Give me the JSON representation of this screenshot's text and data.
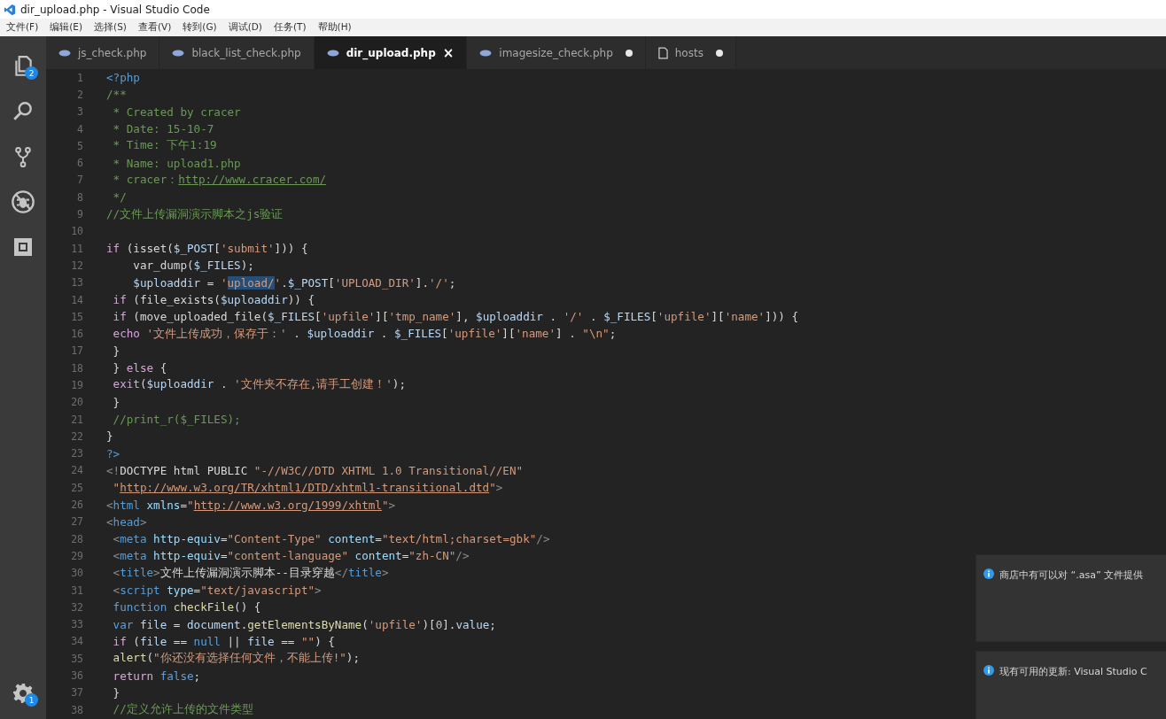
{
  "window": {
    "title": "dir_upload.php - Visual Studio Code"
  },
  "menu": [
    "文件(F)",
    "编辑(E)",
    "选择(S)",
    "查看(V)",
    "转到(G)",
    "调试(D)",
    "任务(T)",
    "帮助(H)"
  ],
  "activity_bar": {
    "items": [
      {
        "kind": "files",
        "badge": "2"
      },
      {
        "kind": "search"
      },
      {
        "kind": "git"
      },
      {
        "kind": "debug"
      },
      {
        "kind": "extensions"
      }
    ],
    "bottom": {
      "kind": "settings",
      "badge": "1"
    }
  },
  "tabs": [
    {
      "label": "js_check.php",
      "kind": "php",
      "selected": false,
      "dirty": false
    },
    {
      "label": "black_list_check.php",
      "kind": "php",
      "selected": false,
      "dirty": false
    },
    {
      "label": "dir_upload.php",
      "kind": "php",
      "selected": true,
      "dirty": false,
      "close": "×"
    },
    {
      "label": "imagesize_check.php",
      "kind": "php",
      "selected": false,
      "dirty": true
    },
    {
      "label": "hosts",
      "kind": "file",
      "selected": false,
      "dirty": true
    }
  ],
  "code": [
    {
      "num": "1",
      "tokens": [
        {
          "kind": "tag",
          "text": "<?php"
        }
      ]
    },
    {
      "num": "2",
      "tokens": [
        {
          "kind": "com",
          "text": "/**"
        }
      ]
    },
    {
      "num": "3",
      "tokens": [
        {
          "kind": "com",
          "text": " * Created by cracer"
        }
      ]
    },
    {
      "num": "4",
      "tokens": [
        {
          "kind": "com",
          "text": " * Date: 15-10-7"
        }
      ]
    },
    {
      "num": "5",
      "tokens": [
        {
          "kind": "com",
          "text": " * Time: 下午1:19"
        }
      ]
    },
    {
      "num": "6",
      "tokens": [
        {
          "kind": "com",
          "text": " * Name: upload1.php"
        }
      ]
    },
    {
      "num": "7",
      "tokens": [
        {
          "kind": "com",
          "text": " * cracer："
        },
        {
          "kind": "comlink",
          "text": "http://www.cracer.com/"
        }
      ]
    },
    {
      "num": "8",
      "tokens": [
        {
          "kind": "com",
          "text": " */"
        }
      ]
    },
    {
      "num": "9",
      "tokens": [
        {
          "kind": "com",
          "text": "//文件上传漏洞演示脚本之js验证"
        }
      ]
    },
    {
      "num": "10"
    },
    {
      "num": "11",
      "tokens": [
        {
          "kind": "kw",
          "text": "if"
        },
        {
          "kind": "p",
          "text": " (isset("
        },
        {
          "kind": "var",
          "text": "$_POST"
        },
        {
          "kind": "p",
          "text": "["
        },
        {
          "kind": "str",
          "text": "'submit'"
        },
        {
          "kind": "p",
          "text": "])) {"
        }
      ]
    },
    {
      "num": "12",
      "tokens": [
        {
          "kind": "p",
          "text": "    var_dump("
        },
        {
          "kind": "var",
          "text": "$_FILES"
        },
        {
          "kind": "p",
          "text": ");"
        }
      ]
    },
    {
      "num": "13",
      "tokens": [
        {
          "kind": "var",
          "text": "    $uploaddir"
        },
        {
          "kind": "p",
          "text": " = "
        },
        {
          "kind": "str",
          "text": "'"
        },
        {
          "kind": "sel",
          "text": "upload/"
        },
        {
          "kind": "str",
          "text": "'"
        },
        {
          "kind": "p",
          "text": "."
        },
        {
          "kind": "var",
          "text": "$_POST"
        },
        {
          "kind": "p",
          "text": "["
        },
        {
          "kind": "str",
          "text": "'UPLOAD_DIR'"
        },
        {
          "kind": "p",
          "text": "]."
        },
        {
          "kind": "str",
          "text": "'/'"
        },
        {
          "kind": "p",
          "text": ";"
        }
      ]
    },
    {
      "num": "14",
      "tokens": [
        {
          "kind": "kw",
          "text": " if"
        },
        {
          "kind": "p",
          "text": " (file_exists("
        },
        {
          "kind": "var",
          "text": "$uploaddir"
        },
        {
          "kind": "p",
          "text": ")) {"
        }
      ]
    },
    {
      "num": "15",
      "tokens": [
        {
          "kind": "kw",
          "text": " if"
        },
        {
          "kind": "p",
          "text": " (move_uploaded_file("
        },
        {
          "kind": "var",
          "text": "$_FILES"
        },
        {
          "kind": "p",
          "text": "["
        },
        {
          "kind": "str",
          "text": "'upfile'"
        },
        {
          "kind": "p",
          "text": "]["
        },
        {
          "kind": "str",
          "text": "'tmp_name'"
        },
        {
          "kind": "p",
          "text": "], "
        },
        {
          "kind": "var",
          "text": "$uploaddir"
        },
        {
          "kind": "p",
          "text": " . "
        },
        {
          "kind": "str",
          "text": "'/'"
        },
        {
          "kind": "p",
          "text": " . "
        },
        {
          "kind": "var",
          "text": "$_FILES"
        },
        {
          "kind": "p",
          "text": "["
        },
        {
          "kind": "str",
          "text": "'upfile'"
        },
        {
          "kind": "p",
          "text": "]["
        },
        {
          "kind": "str",
          "text": "'name'"
        },
        {
          "kind": "p",
          "text": "])) {"
        }
      ]
    },
    {
      "num": "16",
      "tokens": [
        {
          "kind": "kw",
          "text": " echo "
        },
        {
          "kind": "str",
          "text": "'文件上传成功，保存于：'"
        },
        {
          "kind": "p",
          "text": " . "
        },
        {
          "kind": "var",
          "text": "$uploaddir"
        },
        {
          "kind": "p",
          "text": " . "
        },
        {
          "kind": "var",
          "text": "$_FILES"
        },
        {
          "kind": "p",
          "text": "["
        },
        {
          "kind": "str",
          "text": "'upfile'"
        },
        {
          "kind": "p",
          "text": "]["
        },
        {
          "kind": "str",
          "text": "'name'"
        },
        {
          "kind": "p",
          "text": "] . "
        },
        {
          "kind": "str",
          "text": "\"\\n\""
        },
        {
          "kind": "p",
          "text": ";"
        }
      ]
    },
    {
      "num": "17",
      "tokens": [
        {
          "kind": "p",
          "text": " }"
        }
      ]
    },
    {
      "num": "18",
      "tokens": [
        {
          "kind": "p",
          "text": " } "
        },
        {
          "kind": "kw",
          "text": "else"
        },
        {
          "kind": "p",
          "text": " {"
        }
      ]
    },
    {
      "num": "19",
      "tokens": [
        {
          "kind": "kw",
          "text": " exit"
        },
        {
          "kind": "p",
          "text": "("
        },
        {
          "kind": "var",
          "text": "$uploaddir"
        },
        {
          "kind": "p",
          "text": " . "
        },
        {
          "kind": "str",
          "text": "'文件夹不存在,请手工创建！'"
        },
        {
          "kind": "p",
          "text": ");"
        }
      ]
    },
    {
      "num": "20",
      "tokens": [
        {
          "kind": "p",
          "text": " }"
        }
      ]
    },
    {
      "num": "21",
      "tokens": [
        {
          "kind": "com",
          "text": " //print_r($_FILES);"
        }
      ]
    },
    {
      "num": "22",
      "tokens": [
        {
          "kind": "p",
          "text": "}"
        }
      ]
    },
    {
      "num": "23",
      "tokens": [
        {
          "kind": "tag",
          "text": "?>"
        }
      ]
    },
    {
      "num": "24",
      "tokens": [
        {
          "kind": "punct",
          "text": "<!"
        },
        {
          "kind": "p",
          "text": "DOCTYPE html PUBLIC "
        },
        {
          "kind": "str",
          "text": "\"-//W3C//DTD XHTML 1.0 Transitional//EN\""
        }
      ]
    },
    {
      "num": "25",
      "tokens": [
        {
          "kind": "str",
          "text": " \""
        },
        {
          "kind": "link",
          "text": "http://www.w3.org/TR/xhtml1/DTD/xhtml1-transitional.dtd"
        },
        {
          "kind": "str",
          "text": "\""
        },
        {
          "kind": "punct",
          "text": ">"
        }
      ]
    },
    {
      "num": "26",
      "tokens": [
        {
          "kind": "punct",
          "text": "<"
        },
        {
          "kind": "tag",
          "text": "html"
        },
        {
          "kind": "attr",
          "text": " xmlns"
        },
        {
          "kind": "p",
          "text": "="
        },
        {
          "kind": "str",
          "text": "\""
        },
        {
          "kind": "link",
          "text": "http://www.w3.org/1999/xhtml"
        },
        {
          "kind": "str",
          "text": "\""
        },
        {
          "kind": "punct",
          "text": ">"
        }
      ]
    },
    {
      "num": "27",
      "tokens": [
        {
          "kind": "punct",
          "text": "<"
        },
        {
          "kind": "tag",
          "text": "head"
        },
        {
          "kind": "punct",
          "text": ">"
        }
      ]
    },
    {
      "num": "28",
      "tokens": [
        {
          "kind": "punct",
          "text": " <"
        },
        {
          "kind": "tag",
          "text": "meta"
        },
        {
          "kind": "attr",
          "text": " http-equiv"
        },
        {
          "kind": "p",
          "text": "="
        },
        {
          "kind": "str",
          "text": "\"Content-Type\""
        },
        {
          "kind": "attr",
          "text": " content"
        },
        {
          "kind": "p",
          "text": "="
        },
        {
          "kind": "str",
          "text": "\"text/html;charset=gbk\""
        },
        {
          "kind": "punct",
          "text": "/>"
        }
      ]
    },
    {
      "num": "29",
      "tokens": [
        {
          "kind": "punct",
          "text": " <"
        },
        {
          "kind": "tag",
          "text": "meta"
        },
        {
          "kind": "attr",
          "text": " http-equiv"
        },
        {
          "kind": "p",
          "text": "="
        },
        {
          "kind": "str",
          "text": "\"content-language\""
        },
        {
          "kind": "attr",
          "text": " content"
        },
        {
          "kind": "p",
          "text": "="
        },
        {
          "kind": "str",
          "text": "\"zh-CN\""
        },
        {
          "kind": "punct",
          "text": "/>"
        }
      ]
    },
    {
      "num": "30",
      "tokens": [
        {
          "kind": "punct",
          "text": " <"
        },
        {
          "kind": "tag",
          "text": "title"
        },
        {
          "kind": "punct",
          "text": ">"
        },
        {
          "kind": "p",
          "text": "文件上传漏洞演示脚本--目录穿越"
        },
        {
          "kind": "punct",
          "text": "</"
        },
        {
          "kind": "tag",
          "text": "title"
        },
        {
          "kind": "punct",
          "text": ">"
        }
      ]
    },
    {
      "num": "31",
      "tokens": [
        {
          "kind": "punct",
          "text": " <"
        },
        {
          "kind": "tag",
          "text": "script"
        },
        {
          "kind": "attr",
          "text": " type"
        },
        {
          "kind": "p",
          "text": "="
        },
        {
          "kind": "str",
          "text": "\"text/javascript\""
        },
        {
          "kind": "punct",
          "text": ">"
        }
      ]
    },
    {
      "num": "32",
      "tokens": [
        {
          "kind": "kw2",
          "text": " function "
        },
        {
          "kind": "fn",
          "text": "checkFile"
        },
        {
          "kind": "p",
          "text": "() {"
        }
      ]
    },
    {
      "num": "33",
      "tokens": [
        {
          "kind": "kw2",
          "text": " var"
        },
        {
          "kind": "var",
          "text": " file"
        },
        {
          "kind": "p",
          "text": " = "
        },
        {
          "kind": "var",
          "text": "document"
        },
        {
          "kind": "p",
          "text": "."
        },
        {
          "kind": "fn",
          "text": "getElementsByName"
        },
        {
          "kind": "p",
          "text": "("
        },
        {
          "kind": "str",
          "text": "'upfile'"
        },
        {
          "kind": "p",
          "text": ")["
        },
        {
          "kind": "num",
          "text": "0"
        },
        {
          "kind": "p",
          "text": "]."
        },
        {
          "kind": "var",
          "text": "value"
        },
        {
          "kind": "p",
          "text": ";"
        }
      ]
    },
    {
      "num": "34",
      "tokens": [
        {
          "kind": "kw",
          "text": " if"
        },
        {
          "kind": "p",
          "text": " ("
        },
        {
          "kind": "var",
          "text": "file"
        },
        {
          "kind": "p",
          "text": " == "
        },
        {
          "kind": "kw2",
          "text": "null"
        },
        {
          "kind": "p",
          "text": " || "
        },
        {
          "kind": "var",
          "text": "file"
        },
        {
          "kind": "p",
          "text": " == "
        },
        {
          "kind": "str",
          "text": "\"\""
        },
        {
          "kind": "p",
          "text": ") {"
        }
      ]
    },
    {
      "num": "35",
      "tokens": [
        {
          "kind": "fn",
          "text": " alert"
        },
        {
          "kind": "p",
          "text": "("
        },
        {
          "kind": "str",
          "text": "\"你还没有选择任何文件，不能上传!\""
        },
        {
          "kind": "p",
          "text": ");"
        }
      ]
    },
    {
      "num": "36",
      "tokens": [
        {
          "kind": "kw",
          "text": " return "
        },
        {
          "kind": "kw2",
          "text": "false"
        },
        {
          "kind": "p",
          "text": ";"
        }
      ]
    },
    {
      "num": "37",
      "tokens": [
        {
          "kind": "p",
          "text": " }"
        }
      ]
    },
    {
      "num": "38",
      "tokens": [
        {
          "kind": "com",
          "text": " //定义允许上传的文件类型"
        }
      ]
    }
  ],
  "notifications": [
    {
      "text": "商店中有可以对 “.asa” 文件提供"
    },
    {
      "text": "现有可用的更新: Visual Studio C"
    }
  ]
}
